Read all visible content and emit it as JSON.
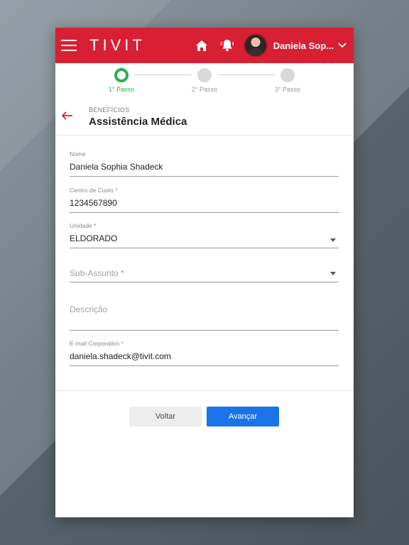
{
  "header": {
    "logo": "TIVIT",
    "user_name": "Daniela Sop...",
    "colors": {
      "brand": "#d81f34"
    },
    "icons": [
      "menu-icon",
      "home-icon",
      "bell-icon",
      "chevron-down-icon"
    ]
  },
  "stepper": {
    "steps": [
      {
        "label": "1° Passo",
        "state": "active"
      },
      {
        "label": "2° Passo",
        "state": "pending"
      },
      {
        "label": "3° Passo",
        "state": "pending"
      }
    ],
    "active_color": "#2ab04a"
  },
  "title": {
    "breadcrumb": "BENEFÍCIOS",
    "heading": "Assistência Médica"
  },
  "form": {
    "nome": {
      "label": "Nome",
      "value": "Daniela Sophia Shadeck"
    },
    "centro_custo": {
      "label": "Centro de Custo *",
      "value": "1234567890"
    },
    "unidade": {
      "label": "Unidade *",
      "value": "ELDORADO"
    },
    "sub_assunto": {
      "placeholder": "Sub-Assunto *"
    },
    "descricao": {
      "placeholder": "Descrição"
    },
    "email": {
      "label": "E-mail Corporativo *",
      "value": "daniela.shadeck@tivit.com"
    }
  },
  "actions": {
    "back_label": "Voltar",
    "next_label": "Avançar",
    "next_color": "#1a73e8"
  }
}
